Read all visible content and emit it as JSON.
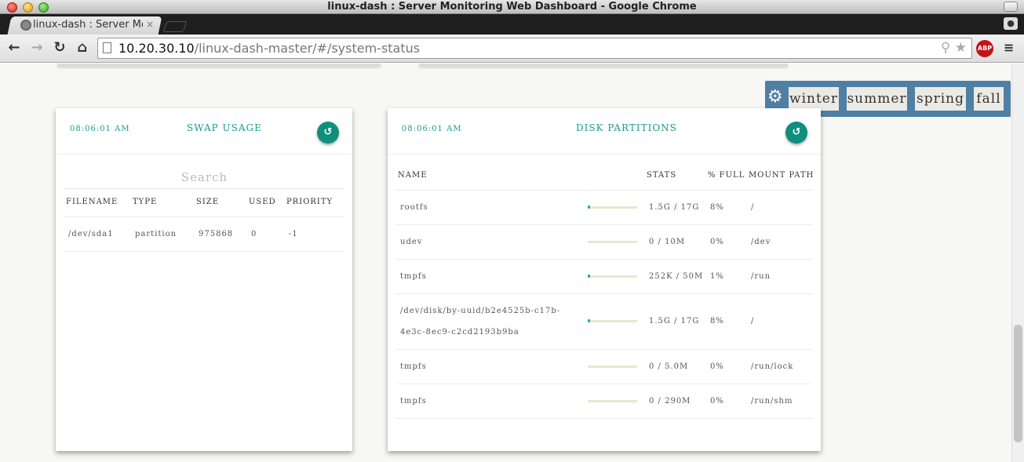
{
  "window": {
    "title": "linux-dash : Server Monitoring Web Dashboard - Google Chrome"
  },
  "tab": {
    "label": "linux-dash : Server Monitoring Web Dashboard",
    "close": "×"
  },
  "toolbar": {
    "url_host": "10.20.30.10",
    "url_path": "/linux-dash-master/#/system-status",
    "abp": "ABP"
  },
  "theme_switcher": {
    "options": [
      "winter",
      "summer",
      "spring",
      "fall"
    ]
  },
  "swap": {
    "time": "08:06:01 AM",
    "title": "SWAP USAGE",
    "search_placeholder": "Search",
    "columns": [
      "FILENAME",
      "TYPE",
      "SIZE",
      "USED",
      "PRIORITY"
    ],
    "rows": [
      [
        "/dev/sda1",
        "partition",
        "975868",
        "0",
        "-1"
      ]
    ]
  },
  "disk": {
    "time": "08:06:01 AM",
    "title": "DISK PARTITIONS",
    "columns": [
      "NAME",
      "STATS",
      "% FULL",
      "MOUNT PATH"
    ],
    "rows": [
      {
        "name": "rootfs",
        "stats": "1.5G / 17G",
        "full": "8%",
        "mount": "/",
        "fill": 0.08
      },
      {
        "name": "udev",
        "stats": "0 / 10M",
        "full": "0%",
        "mount": "/dev",
        "fill": 0
      },
      {
        "name": "tmpfs",
        "stats": "252K / 50M",
        "full": "1%",
        "mount": "/run",
        "fill": 0.01
      },
      {
        "name": "/dev/disk/by-uuid/b2e4525b-c17b-",
        "name2": "4e3c-8ec9-c2cd2193b9ba",
        "stats": "1.5G / 17G",
        "full": "8%",
        "mount": "/",
        "fill": 0.08
      },
      {
        "name": "tmpfs",
        "stats": "0 / 5.0M",
        "full": "0%",
        "mount": "/run/lock",
        "fill": 0
      },
      {
        "name": "tmpfs",
        "stats": "0 / 290M",
        "full": "0%",
        "mount": "/run/shm",
        "fill": 0
      }
    ]
  },
  "colors": {
    "accent": "#1a9c8d",
    "refresh": "#0f8f7d",
    "theme_bar": "#4f7fa3",
    "disk_bar": "#27a3c4",
    "disk_track": "#e8e8cf"
  }
}
